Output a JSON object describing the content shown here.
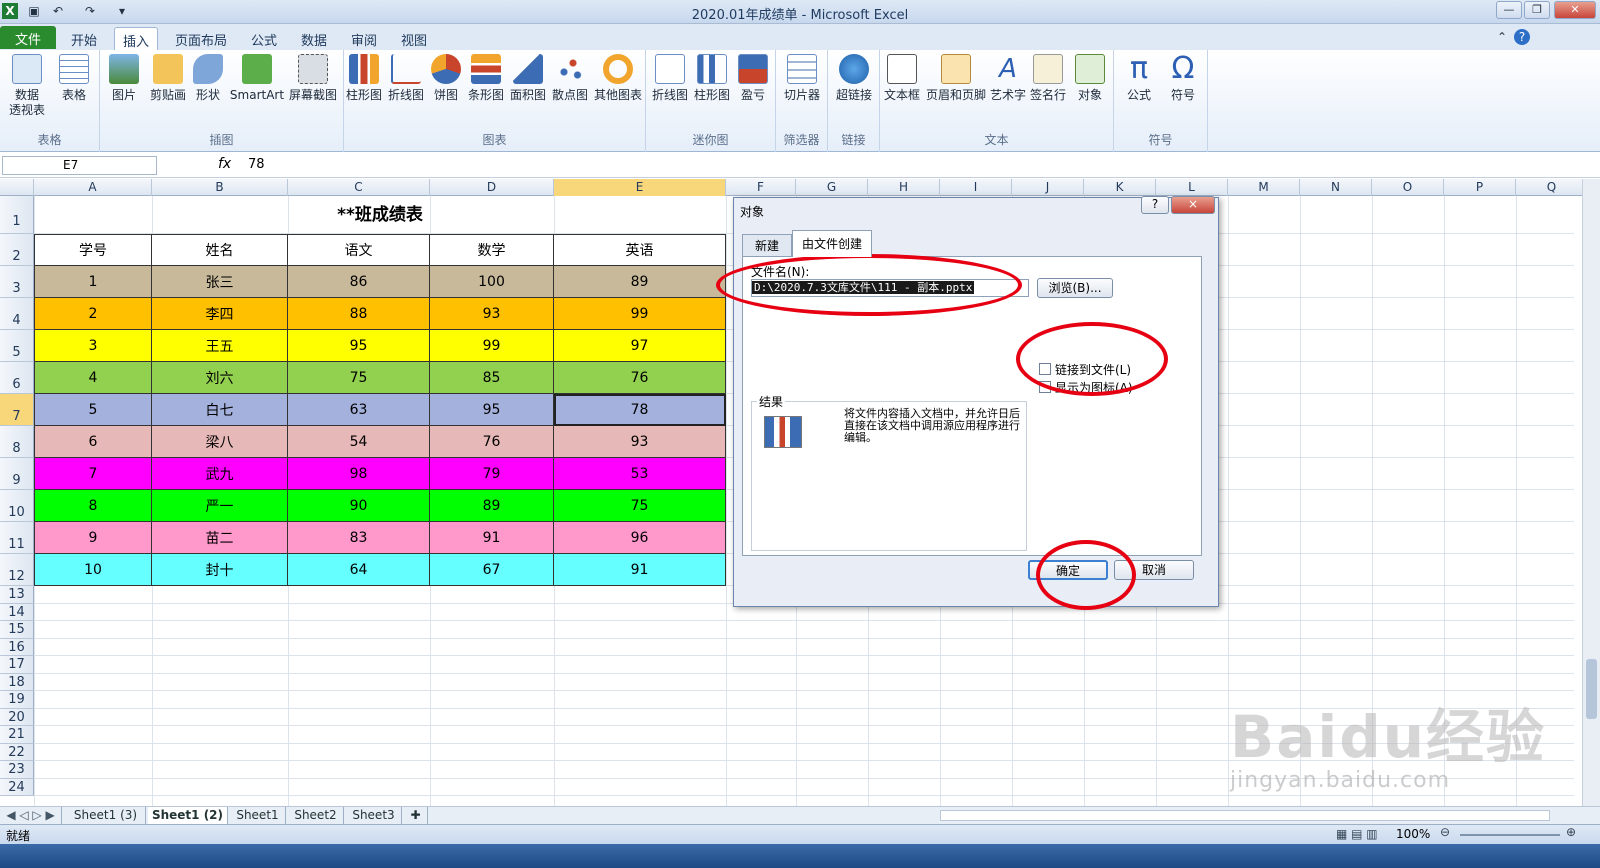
{
  "window": {
    "title": "2020.01年成绩单 - Microsoft Excel"
  },
  "ribbon_tabs": [
    "文件",
    "开始",
    "插入",
    "页面布局",
    "公式",
    "数据",
    "审阅",
    "视图"
  ],
  "ribbon_groups": {
    "table": {
      "label": "表格",
      "buttons": [
        "数据\n透视表",
        "表格"
      ]
    },
    "illustrations": {
      "label": "插图",
      "buttons": [
        "图片",
        "剪贴画",
        "形状",
        "SmartArt",
        "屏幕截图"
      ]
    },
    "charts": {
      "label": "图表",
      "buttons": [
        "柱形图",
        "折线图",
        "饼图",
        "条形图",
        "面积图",
        "散点图",
        "其他图表"
      ]
    },
    "sparklines": {
      "label": "迷你图",
      "buttons": [
        "折线图",
        "柱形图",
        "盈亏"
      ]
    },
    "filter": {
      "label": "筛选器",
      "buttons": [
        "切片器"
      ]
    },
    "links": {
      "label": "链接",
      "buttons": [
        "超链接"
      ]
    },
    "text": {
      "label": "文本",
      "buttons": [
        "文本框",
        "页眉和页脚",
        "艺术字",
        "签名行",
        "对象"
      ]
    },
    "symbols": {
      "label": "符号",
      "buttons": [
        "公式",
        "符号"
      ]
    }
  },
  "formula_bar": {
    "name_box": "E7",
    "fx": "fx",
    "value": "78"
  },
  "columns": [
    "A",
    "B",
    "C",
    "D",
    "E",
    "F",
    "G",
    "H",
    "I",
    "J",
    "K",
    "L",
    "M",
    "N",
    "O",
    "P",
    "Q"
  ],
  "rows": [
    "1",
    "2",
    "3",
    "4",
    "5",
    "6",
    "7",
    "8",
    "9",
    "10",
    "11",
    "12",
    "13",
    "14",
    "15",
    "16",
    "17",
    "18",
    "19",
    "20",
    "21",
    "22",
    "23",
    "24"
  ],
  "table": {
    "title": "**班成绩表",
    "headers": [
      "学号",
      "姓名",
      "语文",
      "数学",
      "英语"
    ],
    "rows": [
      {
        "cells": [
          "1",
          "张三",
          "86",
          "100",
          "89"
        ],
        "color": "#c8b99a"
      },
      {
        "cells": [
          "2",
          "李四",
          "88",
          "93",
          "99"
        ],
        "color": "#ffc000"
      },
      {
        "cells": [
          "3",
          "王五",
          "95",
          "99",
          "97"
        ],
        "color": "#ffff00"
      },
      {
        "cells": [
          "4",
          "刘六",
          "75",
          "85",
          "76"
        ],
        "color": "#92d050"
      },
      {
        "cells": [
          "5",
          "白七",
          "63",
          "95",
          "78"
        ],
        "color": "#a4b1dc"
      },
      {
        "cells": [
          "6",
          "梁八",
          "54",
          "76",
          "93"
        ],
        "color": "#e6b8b7"
      },
      {
        "cells": [
          "7",
          "武九",
          "98",
          "79",
          "53"
        ],
        "color": "#ff00ff"
      },
      {
        "cells": [
          "8",
          "严一",
          "90",
          "89",
          "75"
        ],
        "color": "#00ff00"
      },
      {
        "cells": [
          "9",
          "苗二",
          "83",
          "91",
          "96"
        ],
        "color": "#ff99cc"
      },
      {
        "cells": [
          "10",
          "封十",
          "64",
          "67",
          "91"
        ],
        "color": "#66ffff"
      }
    ]
  },
  "sheet_tabs": [
    "Sheet1 (3)",
    "Sheet1 (2)",
    "Sheet1",
    "Sheet2",
    "Sheet3"
  ],
  "status": {
    "ready": "就绪",
    "zoom": "100%"
  },
  "dialog": {
    "title": "对象",
    "tabs": [
      "新建",
      "由文件创建"
    ],
    "file_label": "文件名(N):",
    "file_value": "D:\\2020.7.3文库文件\\111 - 副本.pptx",
    "browse": "浏览(B)...",
    "link_checkbox": "链接到文件(L)",
    "icon_checkbox": "显示为图标(A)",
    "result_label": "结果",
    "result_text": "将文件内容插入文档中，并允许日后直接在该文档中调用源应用程序进行编辑。",
    "ok": "确定",
    "cancel": "取消",
    "help": "?",
    "close": "×"
  },
  "watermark": "Baidu经验",
  "watermark_url": "jingyan.baidu.com",
  "accent_colors": {
    "file_tab": "#2a8a2e",
    "highlight": "#e60012"
  }
}
